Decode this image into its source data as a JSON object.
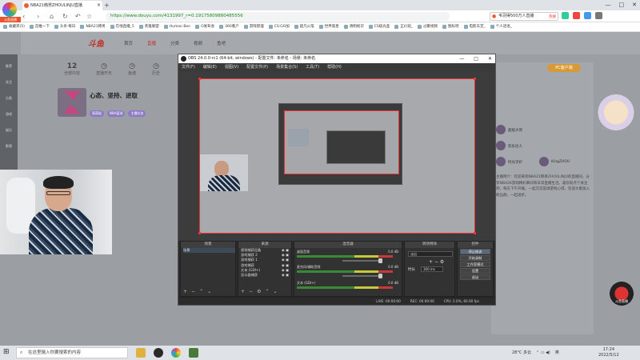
{
  "browser": {
    "tab_title": "NBA21韩男ZHOULINJU直播",
    "url": "https://www.douyu.com/4131997_r=0.19175809880485556",
    "search_value": "韦羽得500万人直播",
    "search_badge": "热搜",
    "bookmarks": [
      "收藏夹(5)",
      "首推一下",
      "头条·每日",
      "NBA21韩男",
      "在线直播_5",
      "英雄联盟",
      "Human Ben",
      "O发布会",
      "360看户",
      "游戏管理",
      "CS:GO加",
      "超凡火笔",
      "世界观星",
      "清明视识",
      "CS极光圣",
      "正价观_",
      "过聚视频",
      "图标吧",
      "电影天堂_",
      "个人话语_"
    ],
    "window_controls": [
      "—",
      "□",
      "✕"
    ]
  },
  "douyu": {
    "logo_text": "斗鱼直播",
    "site_title": "斗鱼",
    "nav": [
      "首页",
      "直播",
      "分类",
      "视频",
      "鱼吧"
    ],
    "stats": [
      {
        "value": "12",
        "label": "全部内容"
      },
      {
        "value": "",
        "label": "直播开天"
      },
      {
        "value": "",
        "label": "鱼塘"
      },
      {
        "value": "",
        "label": "历史"
      }
    ],
    "left_sidebar": [
      "推荐",
      "关注",
      "分类",
      "游戏",
      "娱乐",
      "影视"
    ],
    "channel_title": "心态、坚持、进取",
    "channel_tags": [
      "萌萌哒",
      "NBA篮球",
      "主播任务"
    ],
    "rp_button": "PC客户端",
    "rp_users": [
      "超级大哥",
      "欢乐达人",
      "时光守护",
      "KingZHOU"
    ],
    "body_text": "主播简介：欢迎来到NBA21韩男ZHOULINJU的直播间，分享NBA2K游戏精彩瞬间和日常直播生活。喜欢就点个关注吧，每天下午开播，一起交流篮球游戏心得，欢迎大家加入粉丝群，一起进步。",
    "badge_text": "斗鱼直播"
  },
  "obs": {
    "title": "OBS 24.0.0-rc1 (64-bit, windows) - 配置文件: 未命名 - 场景: 未命名",
    "menu": [
      "文件(F)",
      "编辑(E)",
      "视图(V)",
      "配置文件(P)",
      "场景集合(S)",
      "工具(T)",
      "帮助(H)"
    ],
    "docks": {
      "scenes_title": "场景",
      "scenes": [
        "场景"
      ],
      "sources_title": "来源",
      "sources": [
        "视频捕获设备",
        "游戏捕获 2",
        "游戏捕获 1",
        "游戏捕获",
        "文本 (GDI+)",
        "显示器捕获"
      ],
      "mixer_title": "混音器",
      "mixer": [
        {
          "name": "桌面音频",
          "level": "0.0 dB"
        },
        {
          "name": "麦克风/辅助音频",
          "level": "0.0 dB"
        },
        {
          "name": "文本 (GDI+)",
          "level": "0.0 dB"
        }
      ],
      "transitions_title": "转场特效",
      "transition_type": "淡出",
      "duration_label": "时长",
      "duration_value": "300 ms",
      "controls_title": "控件",
      "controls": [
        "停止推流",
        "开始录制",
        "工作室模式",
        "设置",
        "退出"
      ]
    },
    "status": {
      "live": "LIVE: 00:00:00",
      "rec": "REC: 00:00:00",
      "cpu": "CPU: 2.0%, 60.00 fps"
    }
  },
  "taskbar": {
    "search_placeholder": "在这里输入你要搜索的内容",
    "weather": "28°C 多云",
    "lang": "英",
    "time": "17:24",
    "date": "2022/5/12"
  }
}
